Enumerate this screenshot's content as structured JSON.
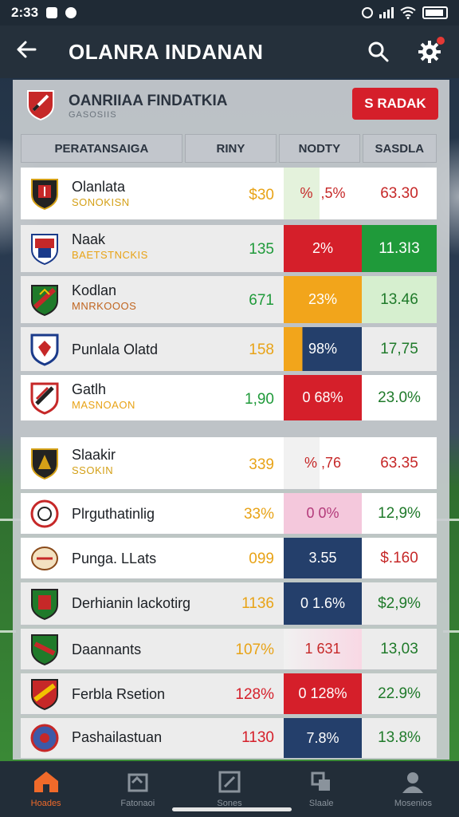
{
  "status": {
    "time": "2:33"
  },
  "appbar": {
    "title": "OLANRA INDANAN"
  },
  "panel": {
    "title": "OANRIIAA FINDATKIA",
    "subtitle": "GASOSIIS",
    "button": "S RADAK",
    "columns": [
      "PERATANSAIGA",
      "RINY",
      "NODTY",
      "SASDLA"
    ]
  },
  "colors": {
    "accent": "#d51f2a",
    "red": "#d51f2a",
    "green": "#1f9a3a",
    "orange": "#f2a51b",
    "navy": "#243f6b",
    "light_green": "#d6efcf",
    "pink": "#f4c8dc"
  },
  "rows": [
    {
      "name": "Olanlata",
      "sub": "SONOKISN",
      "v1": "$30",
      "v2": "% ‍ ‍,5%",
      "v3": "63.30",
      "logo": "shield-icon"
    },
    {
      "name": "Naak",
      "sub": "BAETSTNCKIS",
      "v1": "135",
      "v2": "2%",
      "v3": "11.3I3",
      "logo": "shield-icon"
    },
    {
      "name": "Kodlan",
      "sub": "MNRKOOOS",
      "v1": "671",
      "v2": "23%",
      "v3": "13.46",
      "logo": "shield-icon"
    },
    {
      "name": "Punlala Olatd",
      "sub": "",
      "v1": "158",
      "v2": "98%",
      "v3": "17,75",
      "logo": "shield-icon"
    },
    {
      "name": "Gatlh",
      "sub": "MASNOAON",
      "v1": "1,90",
      "v2": "0  68%",
      "v3": "23.0%",
      "logo": "shield-icon"
    },
    {
      "name": "Slaakir",
      "sub": "SSOKIN",
      "v1": "339",
      "v2": "% ,76",
      "v3": "63.35",
      "logo": "shield-icon"
    },
    {
      "name": "Plrguthatinlig",
      "sub": "",
      "v1": "33%",
      "v2": "0  0%",
      "v3": "12,9%",
      "logo": "shield-icon"
    },
    {
      "name": "Punga. LLats",
      "sub": "",
      "v1": "099",
      "v2": "3.55",
      "v3": "$.160",
      "logo": "shield-icon"
    },
    {
      "name": "Derhianin lackotirg",
      "sub": "",
      "v1": "1136",
      "v2": "0  1.6%",
      "v3": "$2,9%",
      "logo": "shield-icon"
    },
    {
      "name": "Daannants",
      "sub": "",
      "v1": "107%",
      "v2": "1  631",
      "v3": "13,03",
      "logo": "shield-icon"
    },
    {
      "name": "Ferbla Rsetion",
      "sub": "",
      "v1": "128%",
      "v2": "0  128%",
      "v3": "22.9%",
      "logo": "shield-icon"
    },
    {
      "name": "Pashailastuan",
      "sub": "",
      "v1": "1130",
      "v2": "7.8%",
      "v3": "13.8%",
      "logo": "shield-icon"
    }
  ],
  "nav": [
    {
      "label": "Hoades",
      "icon": "home-icon"
    },
    {
      "label": "Fatonaoi",
      "icon": "fixtures-icon"
    },
    {
      "label": "Sones",
      "icon": "edit-icon"
    },
    {
      "label": "Slaale",
      "icon": "stats-icon"
    },
    {
      "label": "Mosenios",
      "icon": "profile-icon"
    }
  ]
}
